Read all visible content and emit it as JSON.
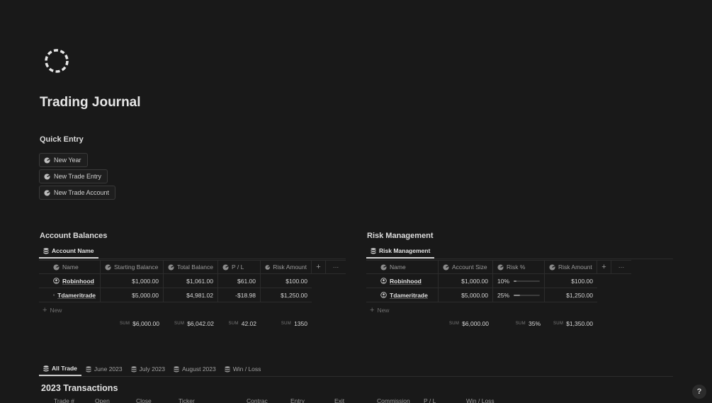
{
  "page": {
    "title": "Trading Journal"
  },
  "quick_entry": {
    "heading": "Quick Entry",
    "buttons": [
      "New Year",
      "New Trade Entry",
      "New Trade Account"
    ]
  },
  "account_balances": {
    "heading": "Account Balances",
    "tab": "Account Name",
    "columns": [
      "Name",
      "Starting Balance",
      "Total Balance",
      "P / L",
      "Risk Amount"
    ],
    "rows": [
      [
        "Robinhood",
        "$1,000.00",
        "$1,061.00",
        "$61.00",
        "$100.00"
      ],
      [
        "Tdameritrade",
        "$5,000.00",
        "$4,981.02",
        "-$18.98",
        "$1,250.00"
      ]
    ],
    "new_label": "New",
    "sum_label": "SUM",
    "sums": [
      "$6,000.00",
      "$6,042.02",
      "42.02",
      "1350"
    ]
  },
  "risk_management": {
    "heading": "Risk Management",
    "tab": "Risk Management",
    "columns": [
      "Name",
      "Account Size",
      "Risk %",
      "Risk Amount"
    ],
    "rows": [
      [
        "Robinhood",
        "$1,000.00",
        "10%",
        "$100.00"
      ],
      [
        "Tdameritrade",
        "$5,000.00",
        "25%",
        "$1,250.00"
      ]
    ],
    "risk_fraction": [
      0.1,
      0.25
    ],
    "new_label": "New",
    "sum_label": "SUM",
    "sums": [
      "$6,000.00",
      "35%",
      "$1,350.00"
    ]
  },
  "transactions": {
    "tabs": [
      "All Trade",
      "June 2023",
      "July 2023",
      "August 2023",
      "Win / Loss"
    ],
    "title": "2023 Transactions",
    "columns": [
      "Trade #",
      "Open",
      "Close",
      "Ticker",
      "Contrac",
      "Entry",
      "Exit",
      "Commission",
      "P / L",
      "Win / Loss"
    ]
  },
  "help": {
    "label": "?"
  },
  "symbols": {
    "plus": "+",
    "more": "···"
  }
}
